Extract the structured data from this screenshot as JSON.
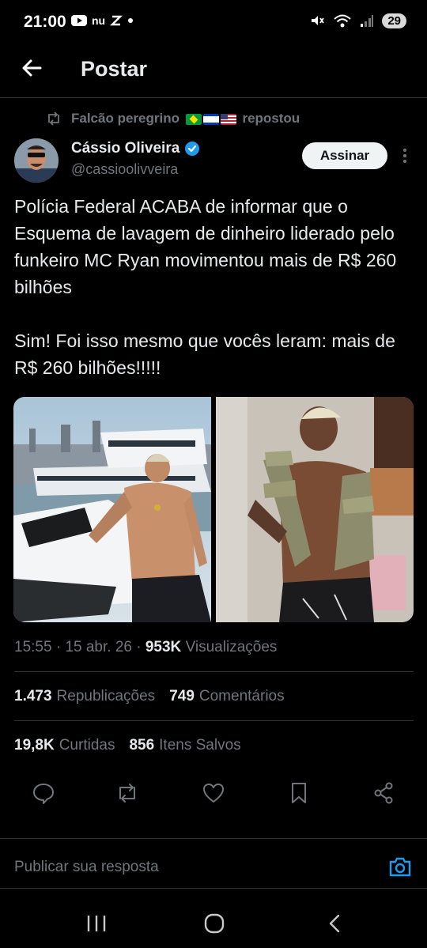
{
  "status_bar": {
    "time": "21:00",
    "left_icons": [
      "youtube-icon",
      "nubank-icon",
      "app-icon",
      "dot-icon"
    ],
    "battery": "29"
  },
  "header": {
    "title": "Postar"
  },
  "repost": {
    "name": "Falcão peregrino",
    "flags": [
      "brazil-flag",
      "israel-flag",
      "usa-flag"
    ],
    "suffix": "repostou"
  },
  "author": {
    "name": "Cássio Oliveira",
    "handle": "@cassioolivveira",
    "subscribe_label": "Assinar"
  },
  "tweet": {
    "paragraph1": "Polícia Federal ACABA de informar que o Esquema de lavagem de dinheiro liderado pelo funkeiro MC Ryan movimentou mais de R$ 260 bilhões",
    "paragraph2": "Sim! Foi isso mesmo que vocês leram: mais de R$ 260 bilhões!!!!!"
  },
  "meta": {
    "time": "15:55",
    "date": "15 abr. 26",
    "views_count": "953K",
    "views_label": "Visualizações"
  },
  "stats": {
    "reposts_count": "1.473",
    "reposts_label": "Republicações",
    "comments_count": "749",
    "comments_label": "Comentários",
    "likes_count": "19,8K",
    "likes_label": "Curtidas",
    "saves_count": "856",
    "saves_label": "Itens Salvos"
  },
  "reply": {
    "placeholder": "Publicar sua resposta"
  },
  "colors": {
    "background": "#000000",
    "text": "#e7e9ea",
    "secondary": "#71767b",
    "accent": "#1d9bf0"
  }
}
